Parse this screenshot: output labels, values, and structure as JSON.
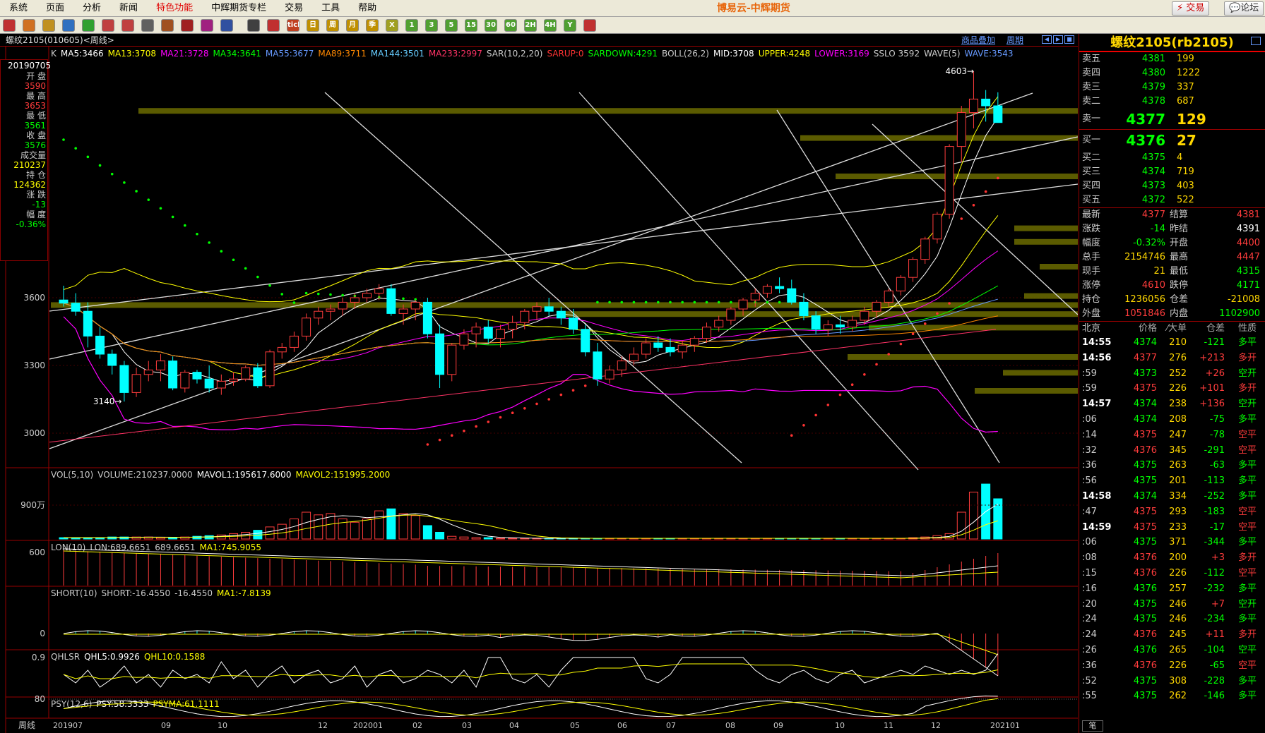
{
  "menu": [
    "系统",
    "页面",
    "分析",
    "新闻",
    "特色功能",
    "中辉期货专栏",
    "交易",
    "工具",
    "帮助"
  ],
  "app_title": "博易云-中辉期货",
  "buttons": {
    "trade": "交易",
    "forum": "论坛"
  },
  "toolbar_icons": [
    "exit-icon",
    "home-icon",
    "open-icon",
    "save-icon",
    "refresh-icon",
    "zoom-in-icon",
    "zoom-out-icon",
    "copy-icon",
    "draw-icon",
    "pen-icon",
    "indicator-icon",
    "color-icon",
    "table-icon",
    "line-chart-icon",
    "tick-icon",
    "day-icon",
    "week-icon",
    "month-icon",
    "quarter-icon",
    "x-icon",
    "1-icon",
    "3-icon",
    "5-icon",
    "15-icon",
    "30-icon",
    "60-icon",
    "2h-icon",
    "4h-icon",
    "y-icon",
    "calc-icon"
  ],
  "toolbar_labels": [
    "",
    "",
    "",
    "",
    "",
    "",
    "",
    "",
    "",
    "",
    "",
    "",
    "",
    "",
    "tick",
    "日",
    "周",
    "月",
    "季",
    "X",
    "1",
    "3",
    "5",
    "15",
    "30",
    "60",
    "2H",
    "4H",
    "Y",
    ""
  ],
  "chart": {
    "symbol_label": "螺纹2105(010605)<周线>",
    "overlay_link": "商品叠加",
    "period_link": "周期",
    "main_indicators": [
      {
        "t": "K",
        "c": "#ccc"
      },
      {
        "t": "MA5:3466",
        "c": "#fff"
      },
      {
        "t": "MA13:3708",
        "c": "#ffff00"
      },
      {
        "t": "MA21:3728",
        "c": "#ff00ff"
      },
      {
        "t": "MA34:3641",
        "c": "#00ff00"
      },
      {
        "t": "MA55:3677",
        "c": "#6699ff"
      },
      {
        "t": "MA89:3711",
        "c": "#ff8800"
      },
      {
        "t": "MA144:3501",
        "c": "#66ccff"
      },
      {
        "t": "MA233:2997",
        "c": "#ff3366"
      },
      {
        "t": "SAR(10,2,20)",
        "c": "#ccc"
      },
      {
        "t": "SARUP:0",
        "c": "#ff3333"
      },
      {
        "t": "SARDOWN:4291",
        "c": "#00ff00"
      },
      {
        "t": "BOLL(26,2)",
        "c": "#ccc"
      },
      {
        "t": "MID:3708",
        "c": "#fff"
      },
      {
        "t": "UPPER:4248",
        "c": "#ffff00"
      },
      {
        "t": "LOWER:3169",
        "c": "#ff00ff"
      },
      {
        "t": "SSLO 3592",
        "c": "#ccc"
      },
      {
        "t": "WAVE(5)",
        "c": "#ccc"
      },
      {
        "t": "WAVE:3543",
        "c": "#6699ff"
      }
    ],
    "y_labels": [
      "3600",
      "3300",
      "3000"
    ],
    "annotations": {
      "high": "4603",
      "low": "3140"
    },
    "vol_header": [
      {
        "t": "VOL(5,10)",
        "c": "#ccc"
      },
      {
        "t": "VOLUME:210237.0000",
        "c": "#ccc"
      },
      {
        "t": "MAVOL1:195617.6000",
        "c": "#fff"
      },
      {
        "t": "MAVOL2:151995.2000",
        "c": "#ffff00"
      }
    ],
    "vol_y": "900万",
    "lon_header": [
      {
        "t": "LON(10)",
        "c": "#ccc"
      },
      {
        "t": "LON:689.6651",
        "c": "#ccc"
      },
      {
        "t": "689.6651",
        "c": "#ccc"
      },
      {
        "t": "MA1:745.9055",
        "c": "#ffff00"
      }
    ],
    "lon_y": "600",
    "short_header": [
      {
        "t": "SHORT(10)",
        "c": "#ccc"
      },
      {
        "t": "SHORT:-16.4550",
        "c": "#ccc"
      },
      {
        "t": "-16.4550",
        "c": "#ccc"
      },
      {
        "t": "MA1:-7.8139",
        "c": "#ffff00"
      }
    ],
    "short_y": "0",
    "qhlsr_header": [
      {
        "t": "QHLSR",
        "c": "#ccc"
      },
      {
        "t": "QHL5:0.9926",
        "c": "#fff"
      },
      {
        "t": "QHL10:0.1588",
        "c": "#ffff00"
      }
    ],
    "qhlsr_y": "0.9",
    "psy_header": [
      {
        "t": "PSY(12,6)",
        "c": "#ccc"
      },
      {
        "t": "PSY:58.3333",
        "c": "#fff"
      },
      {
        "t": "PSYMA:61.1111",
        "c": "#ffff00"
      }
    ],
    "psy_y": "80",
    "x_axis_label": "周线",
    "x_labels": [
      "201907",
      "09",
      "10",
      "12",
      "202001",
      "02",
      "03",
      "04",
      "05",
      "06",
      "07",
      "08",
      "09",
      "10",
      "11",
      "12",
      "202101"
    ]
  },
  "left_info": {
    "date": "20190705",
    "rows": [
      {
        "label": "开  盘",
        "value": "3590",
        "vc": "#ff3c3c"
      },
      {
        "label": "最  高",
        "value": "3653",
        "vc": "#ff3c3c"
      },
      {
        "label": "最  低",
        "value": "3561",
        "vc": "#00ff00"
      },
      {
        "label": "收  盘",
        "value": "3576",
        "vc": "#00ff00"
      },
      {
        "label": "成交量",
        "value": "210237",
        "vc": "#ffff00"
      },
      {
        "label": "持  仓",
        "value": "124362",
        "vc": "#ffff00"
      },
      {
        "label": "涨  跌",
        "value": "-13",
        "vc": "#00ff00"
      },
      {
        "label": "幅  度",
        "value": "-0.36%",
        "vc": "#00ff00"
      }
    ]
  },
  "right": {
    "title": "螺纹2105(rb2105)",
    "asks": [
      {
        "label": "卖五",
        "price": "4381",
        "vol": "199"
      },
      {
        "label": "卖四",
        "price": "4380",
        "vol": "1222"
      },
      {
        "label": "卖三",
        "price": "4379",
        "vol": "337"
      },
      {
        "label": "卖二",
        "price": "4378",
        "vol": "687"
      }
    ],
    "ask1": {
      "label": "卖一",
      "price": "4377",
      "vol": "129"
    },
    "bid1": {
      "label": "买一",
      "price": "4376",
      "vol": "27"
    },
    "bids": [
      {
        "label": "买二",
        "price": "4375",
        "vol": "4"
      },
      {
        "label": "买三",
        "price": "4374",
        "vol": "719"
      },
      {
        "label": "买四",
        "price": "4373",
        "vol": "403"
      },
      {
        "label": "买五",
        "price": "4372",
        "vol": "522"
      }
    ],
    "stats": [
      {
        "l1": "最新",
        "v1": "4377",
        "c1": "#ff3c3c",
        "l2": "结算",
        "v2": "4381",
        "c2": "#ff3c3c"
      },
      {
        "l1": "涨跌",
        "v1": "-14",
        "c1": "#00ff00",
        "l2": "昨结",
        "v2": "4391",
        "c2": "#fff"
      },
      {
        "l1": "幅度",
        "v1": "-0.32%",
        "c1": "#00ff00",
        "l2": "开盘",
        "v2": "4400",
        "c2": "#ff3c3c"
      },
      {
        "l1": "总手",
        "v1": "2154746",
        "c1": "#ffd700",
        "l2": "最高",
        "v2": "4447",
        "c2": "#ff3c3c"
      },
      {
        "l1": "现手",
        "v1": "21",
        "c1": "#ffd700",
        "l2": "最低",
        "v2": "4315",
        "c2": "#00ff00"
      },
      {
        "l1": "涨停",
        "v1": "4610",
        "c1": "#ff3c3c",
        "l2": "跌停",
        "v2": "4171",
        "c2": "#00ff00"
      },
      {
        "l1": "持仓",
        "v1": "1236056",
        "c1": "#ffd700",
        "l2": "仓差",
        "v2": "-21008",
        "c2": "#ffd700"
      },
      {
        "l1": "外盘",
        "v1": "1051846",
        "c1": "#ff3c3c",
        "l2": "内盘",
        "v2": "1102900",
        "c2": "#00ff00"
      }
    ],
    "tick_header": {
      "time": "北京",
      "price": "价格",
      "vol": "⁄大单",
      "diff": "仓差",
      "nature": "性质"
    },
    "ticks": [
      {
        "t": "14:55",
        "p": "4374",
        "pc": "#00ff00",
        "v": "210",
        "d": "-121",
        "n": "多平",
        "nc": "#00ff00"
      },
      {
        "t": "14:56",
        "p": "4377",
        "pc": "#ff3c3c",
        "v": "276",
        "d": "+213",
        "n": "多开",
        "nc": "#ff3c3c"
      },
      {
        "t": ":59",
        "p": "4373",
        "pc": "#00ff00",
        "v": "252",
        "d": "+26",
        "n": "空开",
        "nc": "#00ff00"
      },
      {
        "t": ":59",
        "p": "4375",
        "pc": "#ff3c3c",
        "v": "226",
        "d": "+101",
        "n": "多开",
        "nc": "#ff3c3c"
      },
      {
        "t": "14:57",
        "p": "4374",
        "pc": "#00ff00",
        "v": "238",
        "d": "+136",
        "n": "空开",
        "nc": "#00ff00"
      },
      {
        "t": ":06",
        "p": "4374",
        "pc": "#00ff00",
        "v": "208",
        "d": "-75",
        "n": "多平",
        "nc": "#00ff00"
      },
      {
        "t": ":14",
        "p": "4375",
        "pc": "#ff3c3c",
        "v": "247",
        "d": "-78",
        "n": "空平",
        "nc": "#ff3c3c"
      },
      {
        "t": ":32",
        "p": "4376",
        "pc": "#ff3c3c",
        "v": "345",
        "d": "-291",
        "n": "空平",
        "nc": "#ff3c3c"
      },
      {
        "t": ":36",
        "p": "4375",
        "pc": "#00ff00",
        "v": "263",
        "d": "-63",
        "n": "多平",
        "nc": "#00ff00"
      },
      {
        "t": ":56",
        "p": "4375",
        "pc": "#00ff00",
        "v": "201",
        "d": "-113",
        "n": "多平",
        "nc": "#00ff00"
      },
      {
        "t": "14:58",
        "p": "4374",
        "pc": "#00ff00",
        "v": "334",
        "d": "-252",
        "n": "多平",
        "nc": "#00ff00"
      },
      {
        "t": ":47",
        "p": "4375",
        "pc": "#ff3c3c",
        "v": "293",
        "d": "-183",
        "n": "空平",
        "nc": "#ff3c3c"
      },
      {
        "t": "14:59",
        "p": "4375",
        "pc": "#ff3c3c",
        "v": "233",
        "d": "-17",
        "n": "空平",
        "nc": "#ff3c3c"
      },
      {
        "t": ":06",
        "p": "4375",
        "pc": "#00ff00",
        "v": "371",
        "d": "-344",
        "n": "多平",
        "nc": "#00ff00"
      },
      {
        "t": ":08",
        "p": "4376",
        "pc": "#ff3c3c",
        "v": "200",
        "d": "+3",
        "n": "多开",
        "nc": "#ff3c3c"
      },
      {
        "t": ":15",
        "p": "4376",
        "pc": "#ff3c3c",
        "v": "226",
        "d": "-112",
        "n": "空平",
        "nc": "#ff3c3c"
      },
      {
        "t": ":16",
        "p": "4376",
        "pc": "#00ff00",
        "v": "257",
        "d": "-232",
        "n": "多平",
        "nc": "#00ff00"
      },
      {
        "t": ":20",
        "p": "4375",
        "pc": "#00ff00",
        "v": "246",
        "d": "+7",
        "n": "空开",
        "nc": "#00ff00"
      },
      {
        "t": ":24",
        "p": "4375",
        "pc": "#00ff00",
        "v": "246",
        "d": "-234",
        "n": "多平",
        "nc": "#00ff00"
      },
      {
        "t": ":24",
        "p": "4376",
        "pc": "#ff3c3c",
        "v": "245",
        "d": "+11",
        "n": "多开",
        "nc": "#ff3c3c"
      },
      {
        "t": ":26",
        "p": "4376",
        "pc": "#00ff00",
        "v": "265",
        "d": "-104",
        "n": "空平",
        "nc": "#00ff00"
      },
      {
        "t": ":36",
        "p": "4376",
        "pc": "#ff3c3c",
        "v": "226",
        "d": "-65",
        "n": "空平",
        "nc": "#ff3c3c"
      },
      {
        "t": ":52",
        "p": "4375",
        "pc": "#00ff00",
        "v": "308",
        "d": "-228",
        "n": "多平",
        "nc": "#00ff00"
      },
      {
        "t": ":55",
        "p": "4375",
        "pc": "#00ff00",
        "v": "262",
        "d": "-146",
        "n": "多平",
        "nc": "#00ff00"
      }
    ],
    "bottom_tab": "笔"
  },
  "chart_data": {
    "type": "candlestick",
    "period": "weekly",
    "ylim": [
      2850,
      4650
    ],
    "candles": [
      [
        3590,
        3653,
        3561,
        3576
      ],
      [
        3576,
        3620,
        3520,
        3540
      ],
      [
        3540,
        3580,
        3380,
        3430
      ],
      [
        3430,
        3470,
        3330,
        3350
      ],
      [
        3350,
        3370,
        3260,
        3300
      ],
      [
        3300,
        3320,
        3140,
        3180
      ],
      [
        3180,
        3290,
        3160,
        3260
      ],
      [
        3260,
        3320,
        3230,
        3280
      ],
      [
        3280,
        3350,
        3230,
        3320
      ],
      [
        3320,
        3340,
        3190,
        3200
      ],
      [
        3200,
        3280,
        3180,
        3270
      ],
      [
        3270,
        3280,
        3220,
        3240
      ],
      [
        3240,
        3300,
        3180,
        3200
      ],
      [
        3200,
        3260,
        3170,
        3230
      ],
      [
        3230,
        3270,
        3210,
        3240
      ],
      [
        3240,
        3300,
        3230,
        3290
      ],
      [
        3290,
        3310,
        3200,
        3210
      ],
      [
        3210,
        3370,
        3200,
        3360
      ],
      [
        3360,
        3400,
        3330,
        3380
      ],
      [
        3380,
        3450,
        3360,
        3430
      ],
      [
        3430,
        3530,
        3410,
        3510
      ],
      [
        3510,
        3560,
        3480,
        3540
      ],
      [
        3540,
        3570,
        3500,
        3550
      ],
      [
        3550,
        3600,
        3520,
        3580
      ],
      [
        3580,
        3620,
        3550,
        3600
      ],
      [
        3600,
        3640,
        3580,
        3620
      ],
      [
        3620,
        3660,
        3590,
        3640
      ],
      [
        3640,
        3660,
        3520,
        3530
      ],
      [
        3530,
        3570,
        3480,
        3550
      ],
      [
        3550,
        3590,
        3500,
        3580
      ],
      [
        3580,
        3600,
        3420,
        3440
      ],
      [
        3440,
        3480,
        3200,
        3260
      ],
      [
        3260,
        3400,
        3230,
        3390
      ],
      [
        3390,
        3460,
        3370,
        3440
      ],
      [
        3440,
        3490,
        3380,
        3470
      ],
      [
        3470,
        3500,
        3400,
        3420
      ],
      [
        3420,
        3480,
        3380,
        3460
      ],
      [
        3460,
        3520,
        3420,
        3490
      ],
      [
        3490,
        3550,
        3460,
        3540
      ],
      [
        3540,
        3580,
        3500,
        3560
      ],
      [
        3560,
        3600,
        3520,
        3540
      ],
      [
        3540,
        3560,
        3480,
        3510
      ],
      [
        3510,
        3550,
        3440,
        3460
      ],
      [
        3460,
        3480,
        3340,
        3360
      ],
      [
        3360,
        3400,
        3210,
        3240
      ],
      [
        3240,
        3300,
        3220,
        3280
      ],
      [
        3280,
        3340,
        3250,
        3320
      ],
      [
        3320,
        3380,
        3300,
        3350
      ],
      [
        3350,
        3420,
        3330,
        3400
      ],
      [
        3400,
        3430,
        3360,
        3380
      ],
      [
        3380,
        3420,
        3340,
        3360
      ],
      [
        3360,
        3410,
        3330,
        3390
      ],
      [
        3390,
        3430,
        3360,
        3420
      ],
      [
        3420,
        3490,
        3400,
        3470
      ],
      [
        3470,
        3520,
        3450,
        3500
      ],
      [
        3500,
        3560,
        3480,
        3550
      ],
      [
        3550,
        3600,
        3520,
        3590
      ],
      [
        3590,
        3640,
        3560,
        3620
      ],
      [
        3620,
        3660,
        3600,
        3650
      ],
      [
        3650,
        3690,
        3620,
        3640
      ],
      [
        3640,
        3680,
        3570,
        3580
      ],
      [
        3580,
        3620,
        3500,
        3520
      ],
      [
        3520,
        3540,
        3440,
        3460
      ],
      [
        3460,
        3500,
        3430,
        3480
      ],
      [
        3480,
        3520,
        3440,
        3470
      ],
      [
        3470,
        3520,
        3450,
        3500
      ],
      [
        3500,
        3560,
        3480,
        3540
      ],
      [
        3540,
        3590,
        3510,
        3580
      ],
      [
        3580,
        3640,
        3560,
        3630
      ],
      [
        3630,
        3700,
        3610,
        3690
      ],
      [
        3690,
        3780,
        3670,
        3770
      ],
      [
        3770,
        3870,
        3750,
        3860
      ],
      [
        3860,
        3980,
        3840,
        3970
      ],
      [
        3970,
        4280,
        3950,
        4270
      ],
      [
        4270,
        4450,
        4200,
        4420
      ],
      [
        4420,
        4603,
        4350,
        4480
      ],
      [
        4480,
        4520,
        4380,
        4450
      ],
      [
        4450,
        4510,
        4390,
        4376
      ]
    ]
  }
}
